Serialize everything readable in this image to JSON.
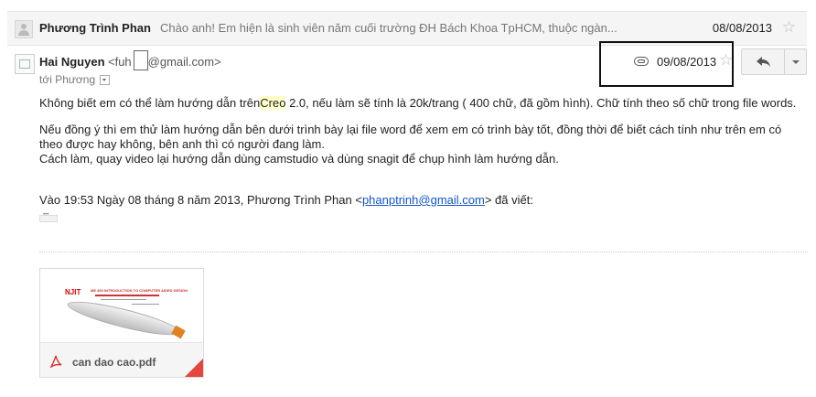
{
  "collapsed_message": {
    "sender": "Phương Trình Phan",
    "snippet": "Chào anh! Em hiện là sinh viên năm cuối trường ĐH Bách Khoa TpHCM, thuộc ngàn...",
    "date": "08/08/2013"
  },
  "message": {
    "from_name": "Hai Nguyen",
    "from_email_start": "<fuh",
    "from_email_end": "@gmail.com>",
    "to_label": "tới Phương",
    "date": "09/08/2013",
    "body": {
      "p1_before": "Không biết em có thể làm hướng dẫn trên",
      "p1_highlight": "Creo",
      "p1_after": " 2.0, nếu làm sẽ tính là 20k/trang ( 400 chữ, đã gồm hình). Chữ tính theo số chữ trong file words.",
      "p2": "Nếu đồng ý thì em thử làm hướng dẫn bên dưới trình bày lại file word để xem em có trình bày tốt, đồng thời để biết cách tính như trên em có theo được hay không, bên anh thì có người đang làm.",
      "p3": "Cách làm, quay video lại hướng dẫn dùng camstudio và dùng snagit để chụp hình làm hướng dẫn."
    },
    "quote_prefix": "Vào 19:53 Ngày 08 tháng 8 năm 2013, Phương Trình Phan <",
    "quote_email": "phanptrinh@gmail.com",
    "quote_suffix": "> đã viết:"
  },
  "attachment": {
    "filename": "can dao cao.pdf",
    "thumb_logo": "NJIT",
    "thumb_text": "ME 400 INTRODUCTION TO COMPUTER AIDED DESIGN",
    "file_icon": "pdf-icon",
    "fold_color": "#e5453a"
  },
  "icons": {
    "attachment": "paperclip-icon",
    "star": "star-icon",
    "reply": "reply-icon",
    "more": "chevron-down-icon"
  }
}
